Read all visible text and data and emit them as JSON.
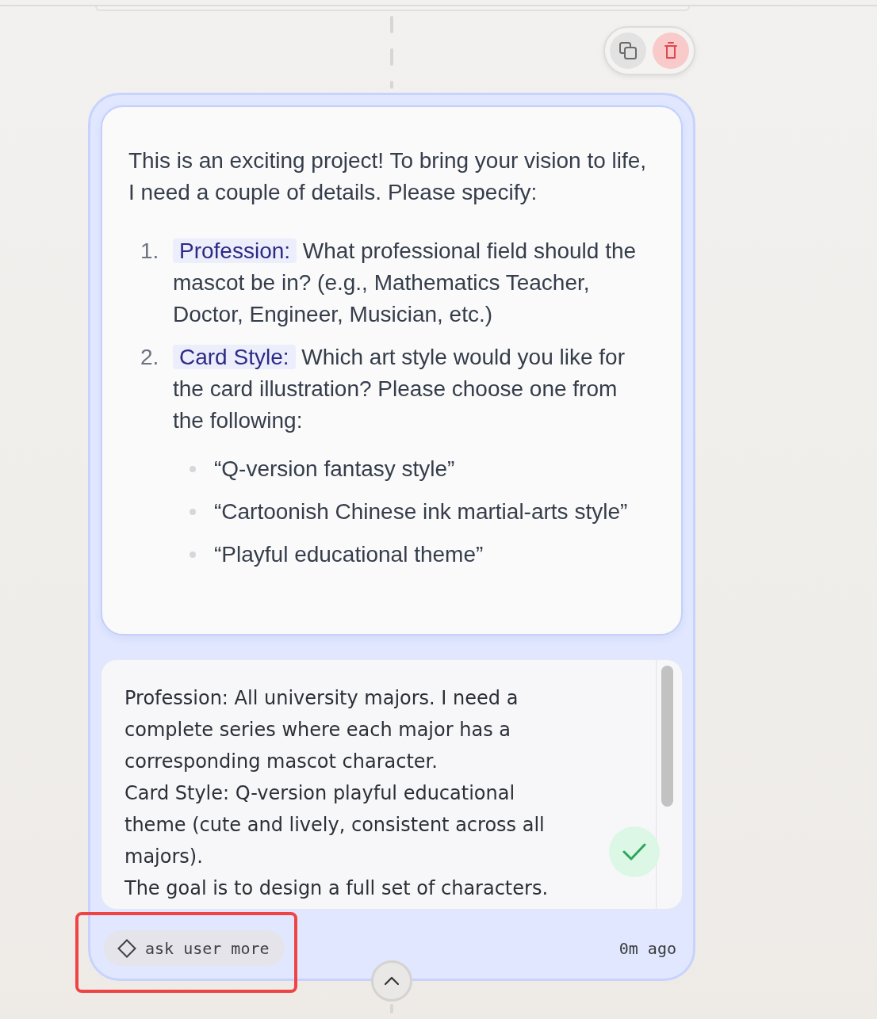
{
  "message": {
    "intro": "This is an exciting project! To bring your vision to life, I need a couple of details. Please specify:",
    "items": [
      {
        "number": "1.",
        "term": "Profession:",
        "text": "What professional field should the mascot be in? (e.g., Mathematics Teacher, Doctor, Engineer, Musician, etc.)"
      },
      {
        "number": "2.",
        "term": "Card Style:",
        "text": "Which art style would you like for the card illustration? Please choose one from the following:",
        "options": [
          "“Q-version fantasy style”",
          "“Cartoonish Chinese ink martial-arts style”",
          "“Playful educational theme”"
        ]
      }
    ]
  },
  "reply": {
    "value": "Profession: All university majors. I need a complete series where each major has a corresponding mascot character.\nCard Style: Q-version playful educational theme (cute and lively, consistent across all majors).\nThe goal is to design a full set of characters."
  },
  "tool_tag": {
    "label": "ask user more",
    "highlighted": true
  },
  "timestamp": "0m ago"
}
